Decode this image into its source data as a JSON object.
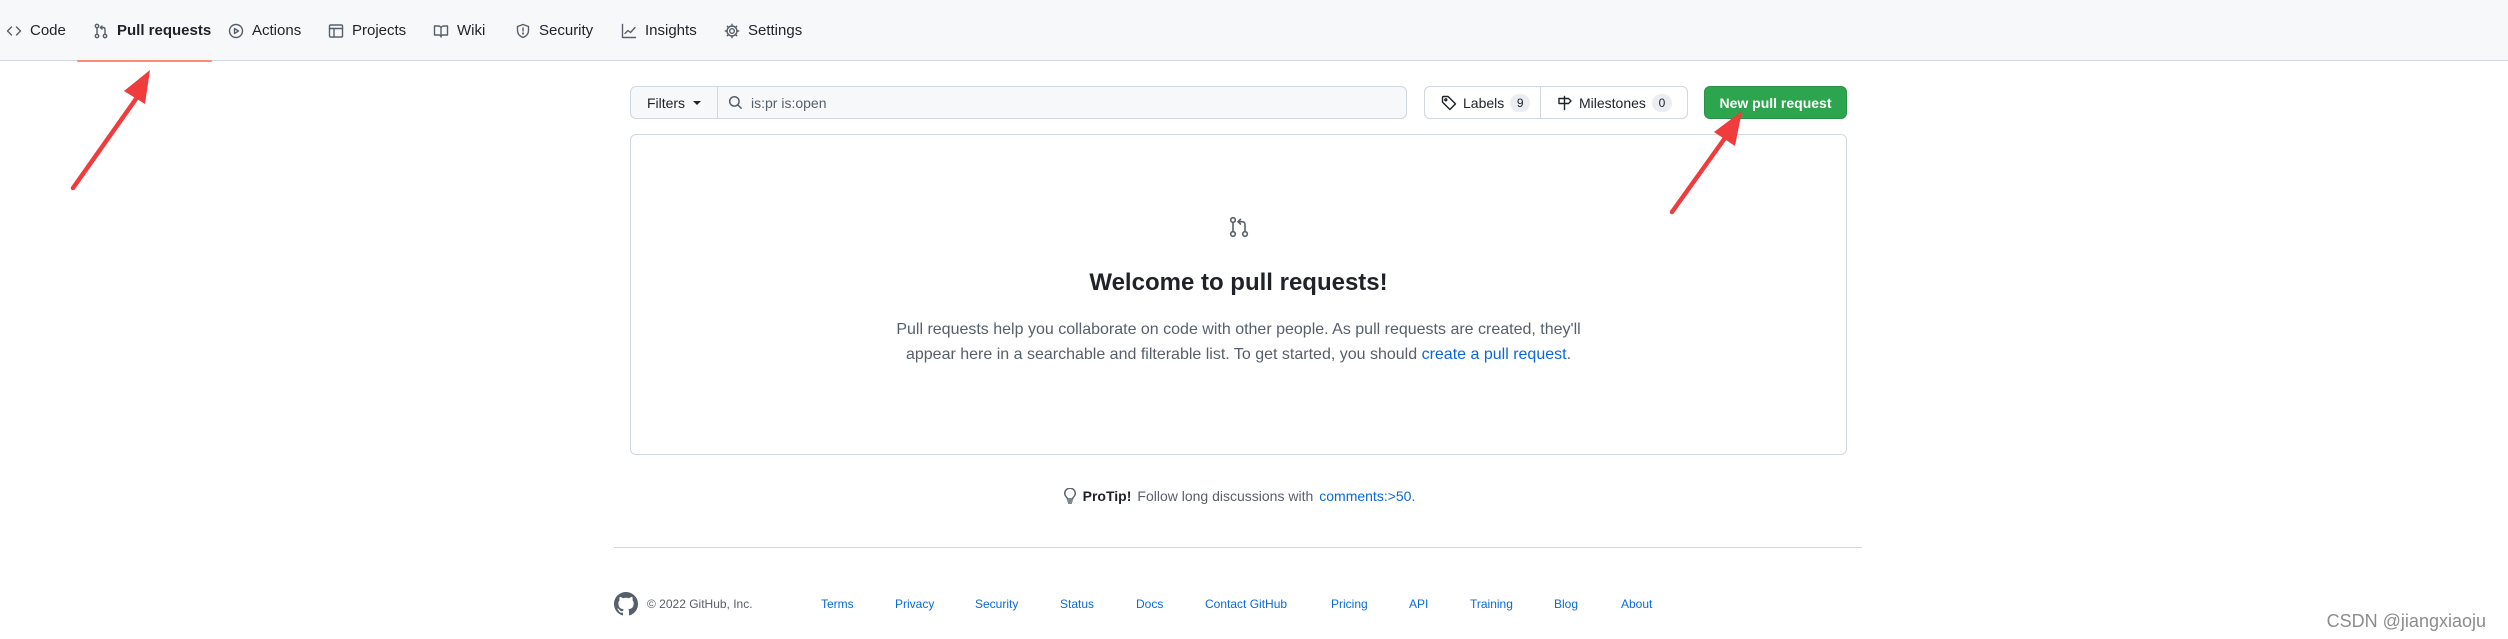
{
  "nav": {
    "tabs": [
      {
        "label": "Code",
        "icon": "code-icon",
        "active": false
      },
      {
        "label": "Pull requests",
        "icon": "git-pull-request-icon",
        "active": true
      },
      {
        "label": "Actions",
        "icon": "play-icon",
        "active": false
      },
      {
        "label": "Projects",
        "icon": "table-icon",
        "active": false
      },
      {
        "label": "Wiki",
        "icon": "book-icon",
        "active": false
      },
      {
        "label": "Security",
        "icon": "shield-icon",
        "active": false
      },
      {
        "label": "Insights",
        "icon": "graph-icon",
        "active": false
      },
      {
        "label": "Settings",
        "icon": "gear-icon",
        "active": false
      }
    ]
  },
  "filterbar": {
    "filters_label": "Filters",
    "search_value": "is:pr is:open",
    "labels_label": "Labels",
    "labels_count": "9",
    "milestones_label": "Milestones",
    "milestones_count": "0",
    "new_pr_label": "New pull request"
  },
  "blankslate": {
    "icon": "git-pull-request-icon",
    "title": "Welcome to pull requests!",
    "description_line1": "Pull requests help you collaborate on code with other people. As pull requests are created, they'll",
    "description_line2_prefix": "appear here in a searchable and filterable list. To get started, you should ",
    "description_link": "create a pull request",
    "description_suffix": "."
  },
  "protip": {
    "label": "ProTip!",
    "text": "Follow long discussions with",
    "link": "comments:>50",
    "suffix": "."
  },
  "footer": {
    "copyright": "© 2022 GitHub, Inc.",
    "links": [
      "Terms",
      "Privacy",
      "Security",
      "Status",
      "Docs",
      "Contact GitHub",
      "Pricing",
      "API",
      "Training",
      "Blog",
      "About"
    ]
  },
  "watermark": "CSDN @jiangxiaoju",
  "colors": {
    "accent_green": "#2da44e",
    "link_blue": "#0969da",
    "active_underline": "#fd8c73",
    "annotation_red": "#f03c3c"
  }
}
